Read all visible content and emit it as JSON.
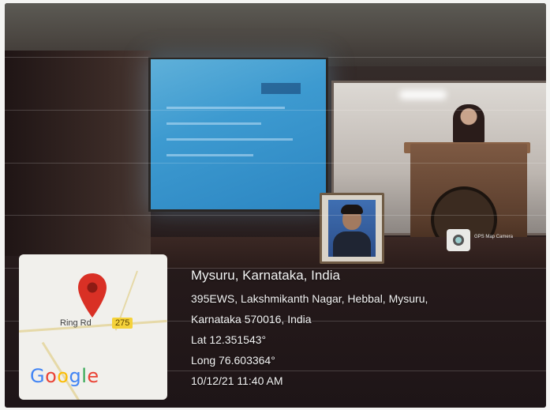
{
  "overlay": {
    "location_title": "Mysuru, Karnataka, India",
    "address_line_1": "395EWS, Lakshmikanth Nagar, Hebbal, Mysuru,",
    "address_line_2": "Karnataka 570016, India",
    "latitude": "Lat 12.351543°",
    "longitude": "Long 76.603364°",
    "datetime": "10/12/21 11:40 AM"
  },
  "map": {
    "road_label": "Ring Rd",
    "route_number": "275",
    "brand": "Google",
    "pin_color": "#d93025",
    "icon": "map-pin-icon"
  },
  "watermark": {
    "label": "GPS Map Camera",
    "icon": "camera-icon"
  }
}
